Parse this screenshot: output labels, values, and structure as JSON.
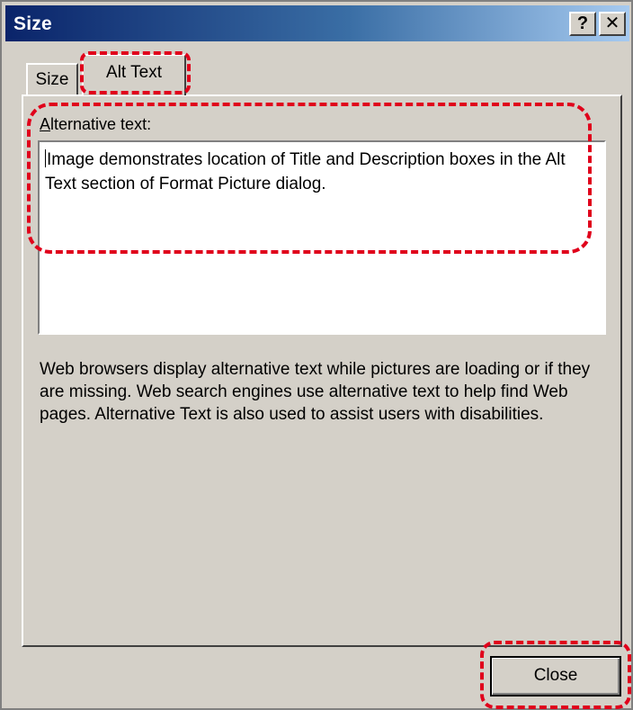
{
  "window": {
    "title": "Size",
    "help_button": "?",
    "close_button": "✕"
  },
  "tabs": [
    {
      "label": "Size",
      "selected": false
    },
    {
      "label": "Alt Text",
      "selected": true
    }
  ],
  "alt_text": {
    "label_mnemonic": "A",
    "label_rest": "lternative text:",
    "value": "Image demonstrates location of Title and Description boxes in the Alt Text section of Format Picture dialog."
  },
  "info": {
    "text": "Web browsers display alternative text while pictures are loading or if they are missing.  Web search engines use alternative text to help find Web pages.  Alternative Text is also used to assist users with disabilities."
  },
  "buttons": {
    "close_label": "Close"
  },
  "colors": {
    "highlight": "#e0001b",
    "title_gradient_start": "#0a246a",
    "dialog_bg": "#d4d0c8"
  }
}
